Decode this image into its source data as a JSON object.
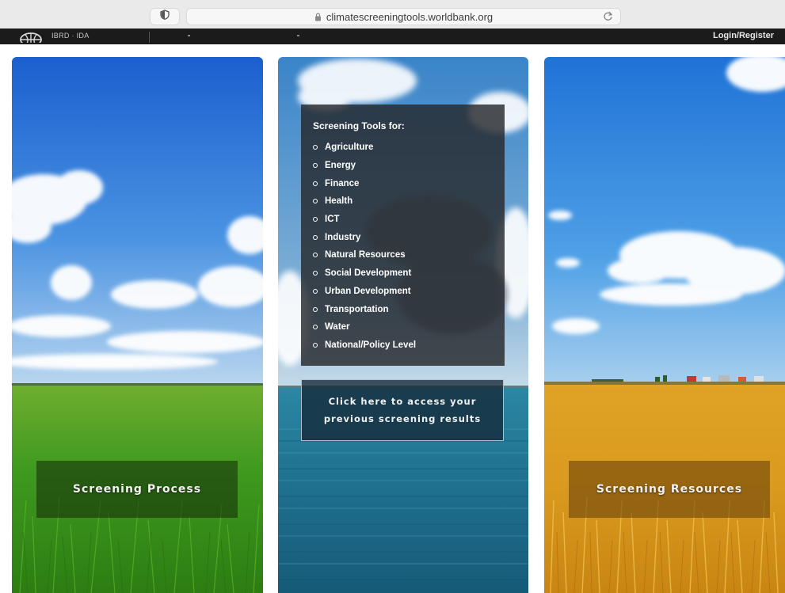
{
  "browser": {
    "url": "climatescreeningtools.worldbank.org"
  },
  "header": {
    "logo_text": "IBRD · IDA",
    "login_label": "Login/Register"
  },
  "panels": {
    "left": {
      "label": "Screening Process"
    },
    "middle": {
      "title": "Screening Tools for:",
      "items": [
        "Agriculture",
        "Energy",
        "Finance",
        "Health",
        "ICT",
        "Industry",
        "Natural Resources",
        "Social Development",
        "Urban Development",
        "Transportation",
        "Water",
        "National/Policy Level"
      ],
      "results_line1": "Click here to access your",
      "results_line2": "previous screening results"
    },
    "right": {
      "label": "Screening Resources"
    }
  },
  "colors": {
    "sky": "#2f7fd6",
    "grass": "#3f9a1f",
    "sea": "#1f6f8e",
    "wheat": "#d99a1e"
  }
}
